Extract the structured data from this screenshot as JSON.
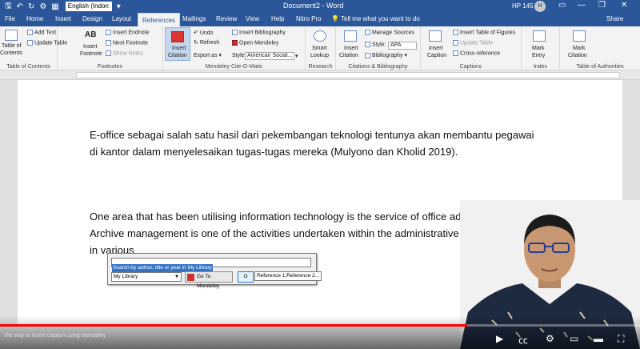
{
  "titlebar": {
    "font_name": "English (Indon",
    "doc_title": "Document2  -  Word",
    "user_label": "HP 145",
    "avatar_initial": "H",
    "win_min": "—",
    "win_restore": "❐",
    "win_close": "✕"
  },
  "tabs": {
    "items": [
      "File",
      "Home",
      "Insert",
      "Design",
      "Layout",
      "References",
      "Mailings",
      "Review",
      "View",
      "Help",
      "Nitro Pro"
    ],
    "tell": "Tell me what you want to do",
    "share": "Share"
  },
  "ribbon": {
    "toc": {
      "btn": "Table of",
      "btn2": "Contents",
      "add_text": "Add Text",
      "update": "Update Table",
      "label": "Table of Contents"
    },
    "footnotes": {
      "ab": "AB",
      "insert": "Insert",
      "insert2": "Footnote",
      "endnote": "Insert Endnote",
      "next": "Next Footnote",
      "show": "Show Notes",
      "label": "Footnotes"
    },
    "mendeley": {
      "insert": "Insert",
      "insert2": "Citation",
      "undo": "Undo",
      "refresh": "Refresh",
      "export": "Export as",
      "insert_bib": "Insert Bibliography",
      "open": "Open Mendeley",
      "style_label": "Style:",
      "style_value": "American Social...",
      "label": "Mendeley Cite-O-Matic"
    },
    "research": {
      "smart": "Smart",
      "smart2": "Lookup",
      "label": "Research"
    },
    "citations": {
      "insert": "Insert",
      "insert2": "Citation",
      "manage": "Manage Sources",
      "style_label": "Style:",
      "style_value": "APA",
      "bibliography": "Bibliography",
      "label": "Citations & Bibliography"
    },
    "captions": {
      "insert": "Insert",
      "insert2": "Caption",
      "tof": "Insert Table of Figures",
      "update": "Update Table",
      "cross": "Cross-reference",
      "label": "Captions"
    },
    "index": {
      "mark": "Mark",
      "mark2": "Entry",
      "label": "Index"
    },
    "toa": {
      "mark": "Mark",
      "mark2": "Citation",
      "label": "Table of Authorities"
    }
  },
  "document": {
    "para1": "E-office sebagai salah satu hasil dari pekembangan teknologi tentunya akan membantu pegawai di kantor dalam menyelesaikan tugas-tugas mereka (Mulyono dan Kholid 2019).",
    "para2": "One area that has been utilising information technology is the service of office administration. Archive management is one of the activities undertaken within the administrative services of o in various"
  },
  "mendeley_dialog": {
    "search_placeholder": "Search by author, title or year in My Library",
    "library": "My Library",
    "go_to": "Go To Mendeley",
    "ok": "O",
    "suggestion": "Reference 1;Reference 2..."
  },
  "video": {
    "caption": "the way to insert citation using Mendeley",
    "progress": 0.73
  }
}
